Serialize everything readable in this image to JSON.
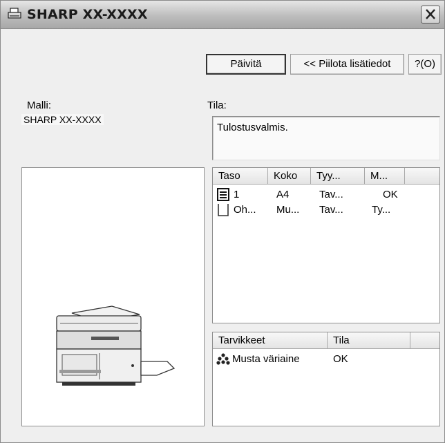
{
  "window": {
    "title": "SHARP XX-XXXX"
  },
  "toolbar": {
    "refresh_label": "Päivitä",
    "hide_details_label": "<< Piilota lisätiedot",
    "help_label": "?(O)"
  },
  "model": {
    "label": "Malli:",
    "value": "SHARP XX-XXXX"
  },
  "status": {
    "label": "Tila:",
    "value": "Tulostusvalmis."
  },
  "trays": {
    "columns": [
      "Taso",
      "Koko",
      "Tyy...",
      "M..."
    ],
    "rows": [
      {
        "icon": "paper-tray-icon",
        "tray": "1",
        "size": "A4",
        "type": "Tav...",
        "status": "OK"
      },
      {
        "icon": "bypass-tray-icon",
        "tray": "Oh...",
        "size": "Mu...",
        "type": "Tav...",
        "status": "Ty..."
      }
    ]
  },
  "supplies": {
    "columns": [
      "Tarvikkeet",
      "Tila"
    ],
    "rows": [
      {
        "icon": "toner-icon",
        "name": "Musta väriaine",
        "status": "OK"
      }
    ]
  }
}
